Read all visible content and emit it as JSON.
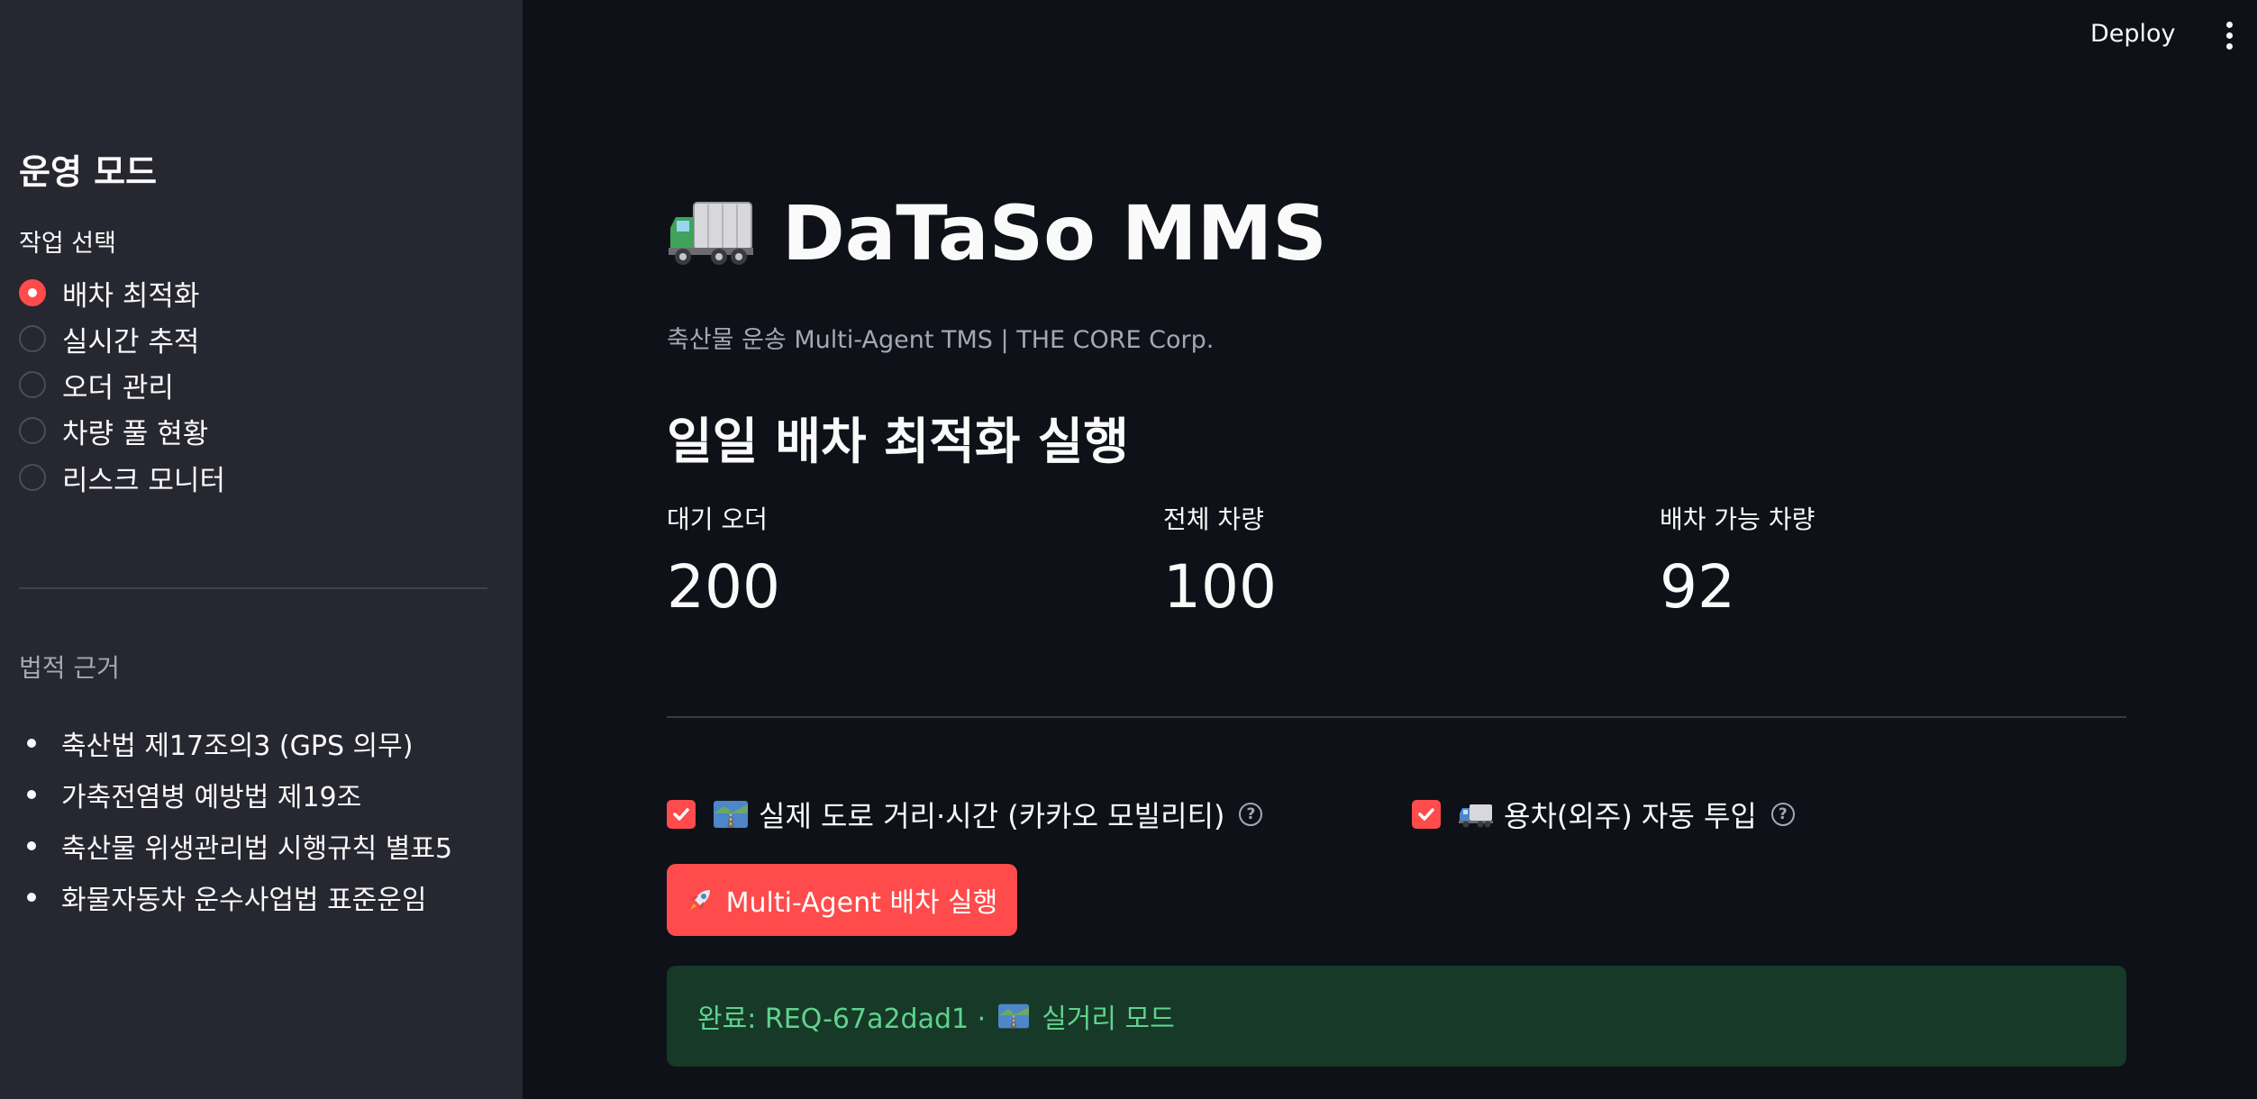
{
  "topbar": {
    "deploy_label": "Deploy"
  },
  "sidebar": {
    "title": "운영 모드",
    "radio_label": "작업 선택",
    "options": [
      "배차 최적화",
      "실시간 추적",
      "오더 관리",
      "차량 풀 현황",
      "리스크 모니터"
    ],
    "selected_index": 0,
    "legal_title": "법적 근거",
    "legal_items": [
      "축산법 제17조의3 (GPS 의무)",
      "가축전염병 예방법 제19조",
      "축산물 위생관리법 시행규칙 별표5",
      "화물자동차 운수사업법 표준운임"
    ]
  },
  "main": {
    "title": "DaTaSo MMS",
    "subtitle": "축산물 운송 Multi-Agent TMS | THE CORE Corp.",
    "section_heading": "일일 배차 최적화 실행",
    "metrics": [
      {
        "label": "대기 오더",
        "value": "200"
      },
      {
        "label": "전체 차량",
        "value": "100"
      },
      {
        "label": "배차 가능 차량",
        "value": "92"
      }
    ],
    "checkboxes": [
      {
        "label": "실제 도로 거리·시간 (카카오 모빌리티)",
        "checked": true,
        "icon": "road-icon"
      },
      {
        "label": "용차(외주) 자동 투입",
        "checked": true,
        "icon": "truck-icon"
      }
    ],
    "run_button_label": "Multi-Agent 배차 실행",
    "success_prefix": "완료: REQ-67a2dad1 ·",
    "success_suffix": "실거리 모드"
  },
  "colors": {
    "accent": "#ff4b4b",
    "background": "#0e1117",
    "sidebar": "#262730",
    "success_bg": "#173928",
    "success_text": "#5fd38d"
  }
}
